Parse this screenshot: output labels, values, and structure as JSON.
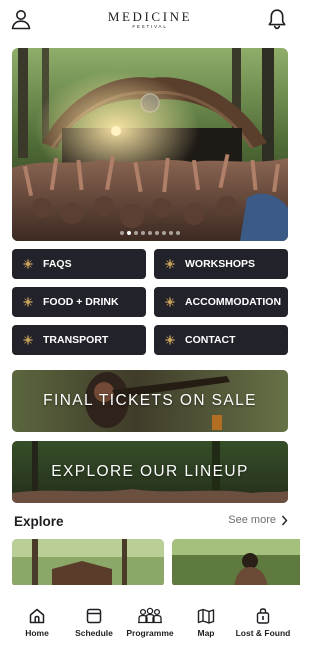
{
  "header": {
    "logo_main": "MEDICINE",
    "logo_sub": "FESTIVAL",
    "user_icon": "user-icon",
    "bell_icon": "bell-icon"
  },
  "hero": {
    "carousel_total": 9,
    "carousel_active": 1
  },
  "quick_links": [
    {
      "label": "FAQS",
      "icon": "emblem-icon"
    },
    {
      "label": "WORKSHOPS",
      "icon": "emblem-icon"
    },
    {
      "label": "FOOD + DRINK",
      "icon": "emblem-icon"
    },
    {
      "label": "ACCOMMODATION",
      "icon": "emblem-icon"
    },
    {
      "label": "TRANSPORT",
      "icon": "emblem-icon"
    },
    {
      "label": "CONTACT",
      "icon": "emblem-icon"
    }
  ],
  "banners": [
    {
      "text": "FINAL TICKETS ON SALE"
    },
    {
      "text": "EXPLORE OUR LINEUP"
    }
  ],
  "explore": {
    "title": "Explore",
    "see_more": "See more"
  },
  "bottom_nav": [
    {
      "label": "Home",
      "icon": "home-icon"
    },
    {
      "label": "Schedule",
      "icon": "calendar-icon"
    },
    {
      "label": "Programme",
      "icon": "people-icon"
    },
    {
      "label": "Map",
      "icon": "map-icon"
    },
    {
      "label": "Lost & Found",
      "icon": "lost-found-icon"
    }
  ],
  "colors": {
    "button_bg": "#22222b",
    "button_text": "#ffffff",
    "emblem_gold": "#c8a15a",
    "text_dark": "#1f1f23",
    "text_muted": "#6e6e73"
  }
}
